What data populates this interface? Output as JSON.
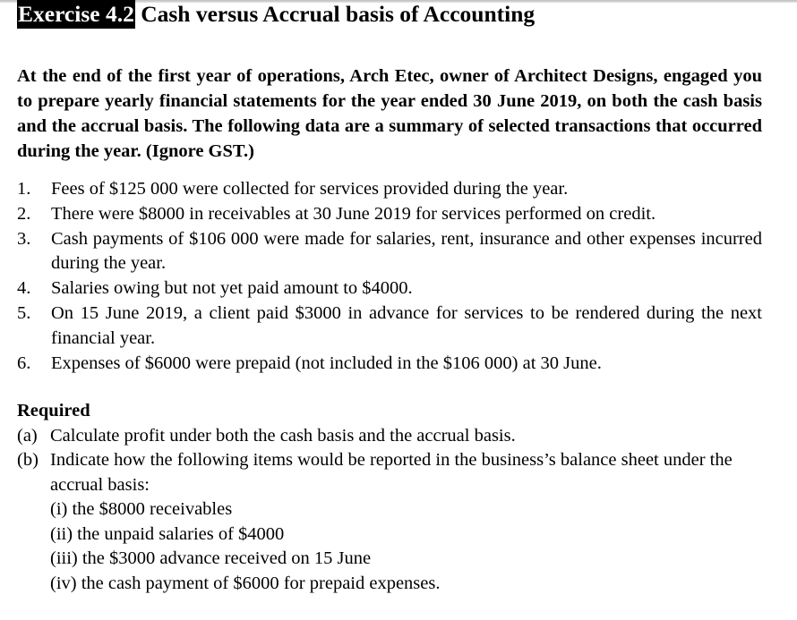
{
  "title": {
    "exercise_number": "Exercise 4.2",
    "heading": "Cash versus Accrual basis of Accounting"
  },
  "intro": "At the end of the first year of operations, Arch Etec, owner of Architect Designs, engaged you to prepare yearly financial statements for the year ended 30 June 2019, on both the cash basis and the accrual basis. The following data are a summary of selected transactions that occurred during the year. (Ignore GST.)",
  "transactions": [
    {
      "num": "1.",
      "text": "Fees of $125 000 were collected for services provided during the year."
    },
    {
      "num": "2.",
      "text": "There were $8000 in receivables at 30 June 2019 for services performed on credit."
    },
    {
      "num": "3.",
      "text": "Cash payments of $106 000 were made for salaries, rent, insurance and other expenses incurred during the year."
    },
    {
      "num": "4.",
      "text": "Salaries owing but not yet paid amount to $4000."
    },
    {
      "num": "5.",
      "text": "On 15 June 2019, a client paid $3000 in advance for services to be rendered during the next financial year."
    },
    {
      "num": "6.",
      "text": "Expenses of $6000 were prepaid (not included in the $106 000) at 30 June."
    }
  ],
  "required": {
    "heading": "Required",
    "parts": [
      {
        "num": "(a)",
        "text": "Calculate profit under both the cash basis and the accrual basis."
      },
      {
        "num": "(b)",
        "text": "Indicate how the following items would be reported in the business’s balance sheet under the accrual basis:"
      }
    ],
    "sub_items": [
      "(i) the $8000 receivables",
      "(ii) the unpaid salaries of $4000",
      "(iii) the $3000 advance received on 15 June",
      "(iv) the cash payment of $6000 for prepaid expenses."
    ]
  }
}
